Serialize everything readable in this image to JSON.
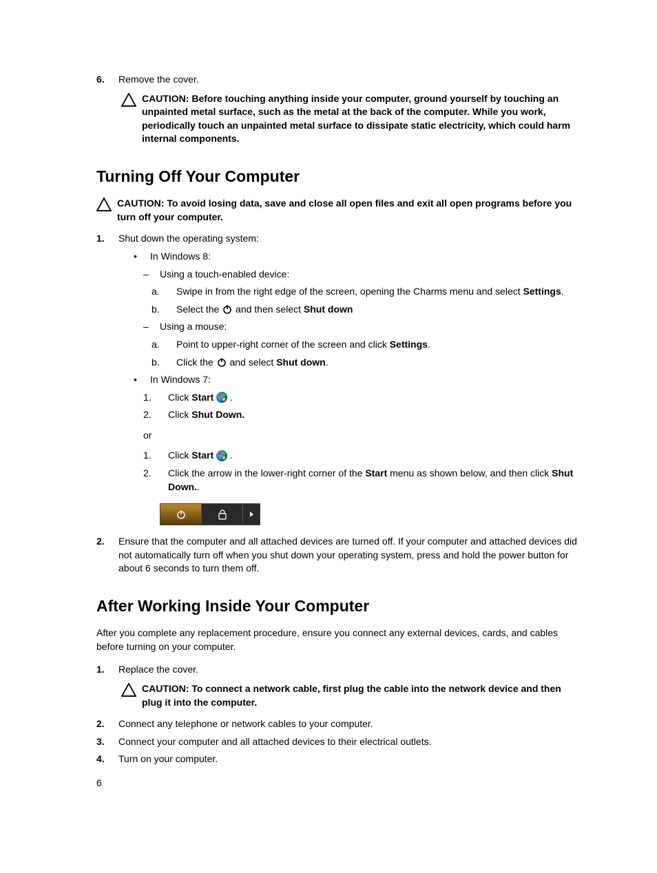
{
  "step6": {
    "num": "6.",
    "text": "Remove the cover."
  },
  "caution_top": {
    "label": "CAUTION:",
    "text": "Before touching anything inside your computer, ground yourself by touching an unpainted metal surface, such as the metal at the back of the computer. While you work, periodically touch an unpainted metal surface to dissipate static electricity, which could harm internal components."
  },
  "heading1": "Turning Off Your Computer",
  "caution_turnoff": {
    "label": "CAUTION:",
    "text": "To avoid losing data, save and close all open files and exit all open programs before you turn off your computer."
  },
  "s1": {
    "num": "1.",
    "text": "Shut down the operating system:",
    "win8_label": "In Windows 8:",
    "touch_label": "Using a touch-enabled device:",
    "touch_a_label": "a.",
    "touch_a_before": "Swipe in from the right edge of the screen, opening the Charms menu and select ",
    "touch_a_bold": "Settings",
    "touch_a_after": ".",
    "touch_b_label": "b.",
    "touch_b_before": "Select the ",
    "touch_b_mid": " and then select ",
    "touch_b_bold": "Shut down",
    "mouse_label": "Using a mouse:",
    "mouse_a_label": "a.",
    "mouse_a_before": "Point to upper-right corner of the screen and click ",
    "mouse_a_bold": "Settings",
    "mouse_a_after": ".",
    "mouse_b_label": "b.",
    "mouse_b_before": "Click the ",
    "mouse_b_mid": " and select ",
    "mouse_b_bold": "Shut down",
    "mouse_b_after": ".",
    "win7_label": "In Windows 7:",
    "w7_1_label": "1.",
    "w7_1_before": "Click ",
    "w7_1_bold": "Start",
    "w7_1_after": " .",
    "w7_2_label": "2.",
    "w7_2_before": "Click ",
    "w7_2_bold": "Shut Down.",
    "or_text": "or",
    "w7b_1_label": "1.",
    "w7b_1_before": "Click ",
    "w7b_1_bold": "Start",
    "w7b_1_after": " .",
    "w7b_2_label": "2.",
    "w7b_2_before": "Click the arrow in the lower-right corner of the ",
    "w7b_2_bold1": "Start",
    "w7b_2_mid": " menu as shown below, and then click ",
    "w7b_2_bold2": "Shut Down.",
    "w7b_2_after": "."
  },
  "s2": {
    "num": "2.",
    "text": "Ensure that the computer and all attached devices are turned off. If your computer and attached devices did not automatically turn off when you shut down your operating system, press and hold the power button for about 6 seconds to turn them off."
  },
  "heading2": "After Working Inside Your Computer",
  "after_para": "After you complete any replacement procedure, ensure you connect any external devices, cards, and cables before turning on your computer.",
  "a1": {
    "num": "1.",
    "text": "Replace the cover."
  },
  "caution_net": {
    "label": "CAUTION:",
    "text": "To connect a network cable, first plug the cable into the network device and then plug it into the computer."
  },
  "a2": {
    "num": "2.",
    "text": "Connect any telephone or network cables to your computer."
  },
  "a3": {
    "num": "3.",
    "text": "Connect your computer and all attached devices to their electrical outlets."
  },
  "a4": {
    "num": "4.",
    "text": "Turn on your computer."
  },
  "page_number": "6"
}
